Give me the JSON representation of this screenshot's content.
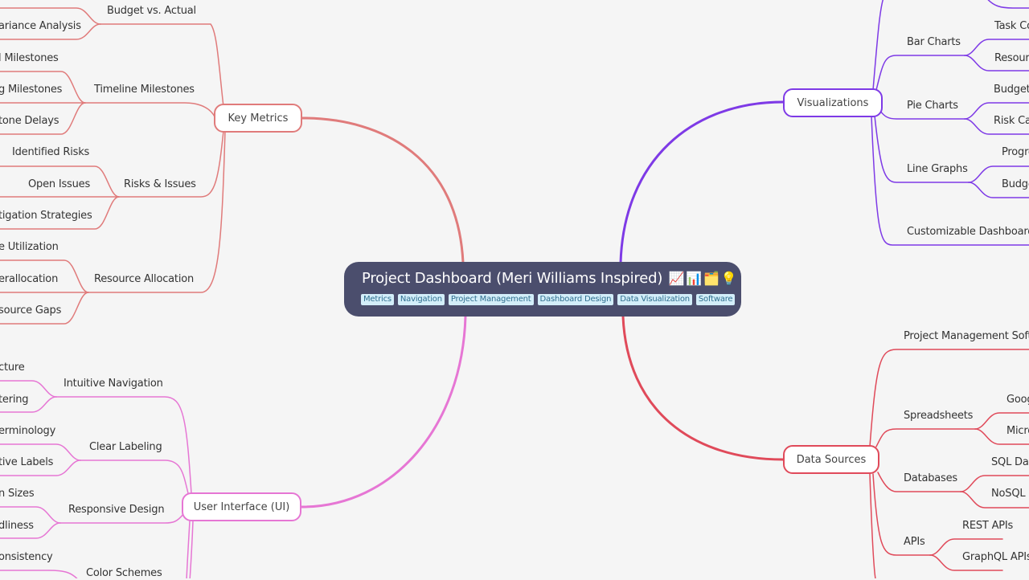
{
  "colors": {
    "background": "#f5f5f5",
    "root": "#4b4e6d",
    "tag_bg": "#d3eef9",
    "tag_text": "#2e6e8e",
    "key_metrics": "#e07b7b",
    "user_interface": "#e676d4",
    "visualizations": "#7e3ae6",
    "data_sources": "#e04a5a"
  },
  "root": {
    "title": "Project Dashboard (Meri Williams Inspired)",
    "emojis": [
      "📈",
      "📊",
      "🗂️",
      "💡"
    ],
    "tags": [
      "Metrics",
      "Navigation",
      "Project Management",
      "Dashboard Design",
      "Data Visualization",
      "Software"
    ]
  },
  "branches": {
    "key_metrics": {
      "label": "Key Metrics",
      "children": [
        {
          "label": "Budget vs. Actual",
          "children": [
            "ariance Analysis"
          ]
        },
        {
          "label": "Timeline Milestones",
          "children": [
            "l Milestones",
            "g Milestones",
            "tone Delays"
          ]
        },
        {
          "label": "Risks & Issues",
          "children": [
            "Identified Risks",
            "Open Issues",
            "tigation Strategies"
          ]
        },
        {
          "label": "Resource Allocation",
          "children": [
            "e Utilization",
            "erallocation",
            "source Gaps"
          ]
        }
      ]
    },
    "user_interface": {
      "label": "User Interface (UI)",
      "children": [
        {
          "label": "Intuitive Navigation",
          "children": [
            "cture",
            "tering"
          ]
        },
        {
          "label": "Clear Labeling",
          "children": [
            "erminology",
            "tive Labels"
          ]
        },
        {
          "label": "Responsive Design",
          "children": [
            "n Sizes",
            "dliness"
          ]
        },
        {
          "label": "Color Schemes",
          "children": [
            "onsistency"
          ]
        }
      ]
    },
    "visualizations": {
      "label": "Visualizations",
      "children": [
        {
          "label": "Bar Charts",
          "children": [
            "Task Co",
            "Resourc"
          ]
        },
        {
          "label": "Pie Charts",
          "children": [
            "Budget",
            "Risk Cat"
          ]
        },
        {
          "label": "Line Graphs",
          "children": [
            "Progre",
            "Budge"
          ]
        },
        {
          "label": "Customizable Dashboards",
          "children": []
        }
      ]
    },
    "data_sources": {
      "label": "Data Sources",
      "children": [
        {
          "label": "Project Management Softw",
          "children": []
        },
        {
          "label": "Spreadsheets",
          "children": [
            "Goog",
            "Micro"
          ]
        },
        {
          "label": "Databases",
          "children": [
            "SQL Dat",
            "NoSQL D"
          ]
        },
        {
          "label": "APIs",
          "children": [
            "REST APIs",
            "GraphQL APIs"
          ]
        }
      ]
    }
  }
}
